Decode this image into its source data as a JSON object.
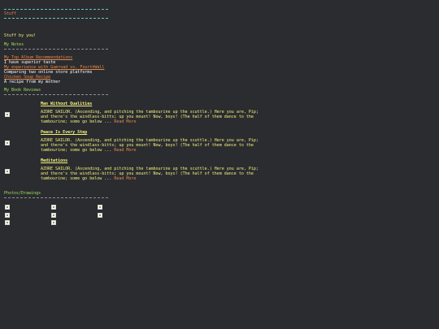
{
  "header": {
    "title": "Stuff"
  },
  "intro": "Stuff by you!",
  "notes": {
    "heading": "My Notes",
    "items": [
      {
        "title": "My Top Album Recommendations",
        "desc": "I have superior taste"
      },
      {
        "title": "My experience with Gumroad vs. FourthWall",
        "desc": "Comparing two online store platforms"
      },
      {
        "title": "Chicken Soup Recipe",
        "desc": "A recipe from my mother"
      }
    ]
  },
  "reviews": {
    "heading": "My Book Reviews",
    "items": [
      {
        "title": "Man Without Qualities",
        "body": "AZORE SAILOR. (Ascending, and pitching the tambourine up the scuttle.) Here you are, Pip; and there's the windlass-bitts; up you mount! Now, boys! (The half of them dance to the tambourine; some go below ... ",
        "read_more": "Read More"
      },
      {
        "title": "Peace Is Every Step",
        "body": "AZORE SAILOR. (Ascending, and pitching the tambourine up the scuttle.) Here you are, Pip; and there's the windlass-bitts; up you mount! Now, boys! (The half of them dance to the tambourine; some go below ... ",
        "read_more": "Read More"
      },
      {
        "title": "Meditations",
        "body": "AZORE SAILOR. (Ascending, and pitching the tambourine up the scuttle.) Here you are, Pip; and there's the windlass-bitts; up you mount! Now, boys! (The half of them dance to the tambourine; some go below ... ",
        "read_more": "Read More"
      }
    ]
  },
  "photos": {
    "heading": "Photos/Drawings",
    "count": 8
  },
  "colors": {
    "background": "#2b2c30",
    "accent_teal": "#5fc9c2",
    "heading_green": "#9ee05a",
    "link_orange": "#e2894c",
    "review_yellow": "#f2f07a"
  }
}
